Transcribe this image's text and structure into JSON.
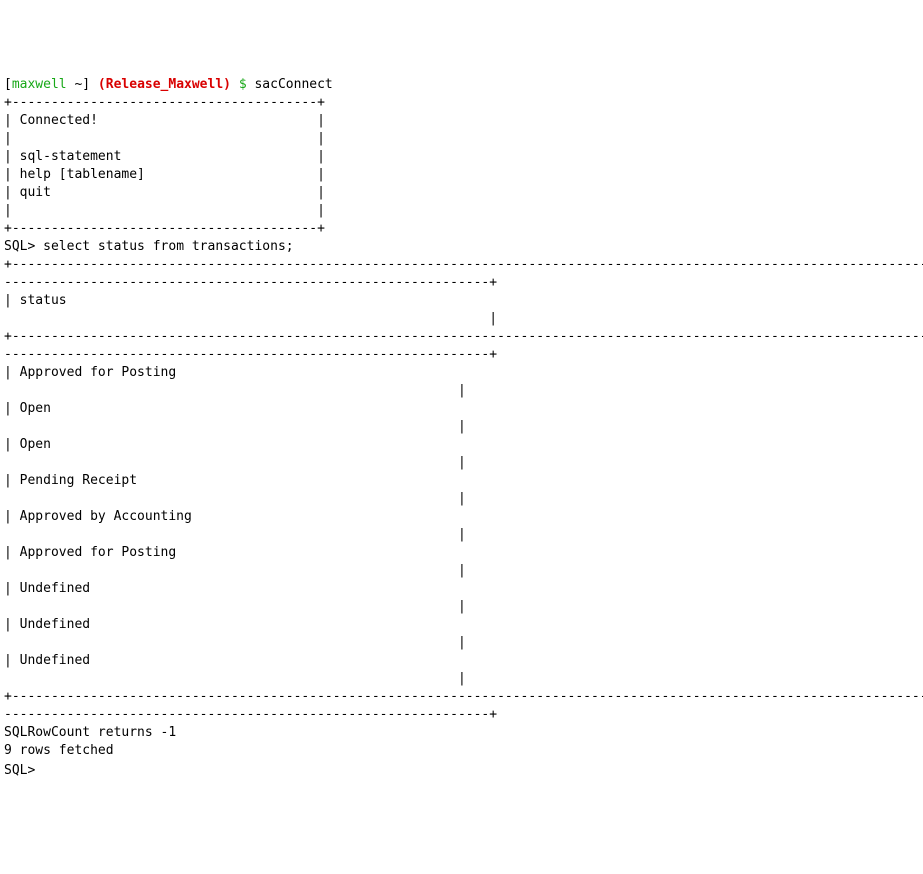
{
  "prompt": {
    "bracket_open": "[",
    "user": "maxwell",
    "tilde": " ~",
    "bracket_close": "]",
    "branch_open": " (",
    "branch": "Release_Maxwell",
    "branch_close": ")",
    "dollar": " $ ",
    "command": "sacConnect"
  },
  "box": {
    "border": "+---------------------------------------+",
    "connected": "| Connected!                            |",
    "blank": "|                                       |",
    "sql": "| sql-statement                         |",
    "help": "| help [tablename]                      |",
    "quit": "| quit                                  |"
  },
  "sql_prompt": "SQL> ",
  "query": "select status from transactions;",
  "hborder1": "+---------------------------------------------------------------------------------------------------------------------------------",
  "hborder2": "--------------------------------------------------------------+",
  "header_col": "| status                                                                                                                          ",
  "header_fill": "                                                              |",
  "row_fill": "                                                          |",
  "rows": {
    "r0": "| Approved for Posting                                                                                                            ",
    "r1": "| Open                                                                                                                            ",
    "r2": "| Open                                                                                                                            ",
    "r3": "| Pending Receipt                                                                                                                 ",
    "r4": "| Approved by Accounting                                                                                                          ",
    "r5": "| Approved for Posting                                                                                                            ",
    "r6": "| Undefined                                                                                                                       ",
    "r7": "| Undefined                                                                                                                       ",
    "r8": "| Undefined                                                                                                                       "
  },
  "footer": {
    "rowcount": "SQLRowCount returns -1",
    "fetched": "9 rows fetched"
  }
}
